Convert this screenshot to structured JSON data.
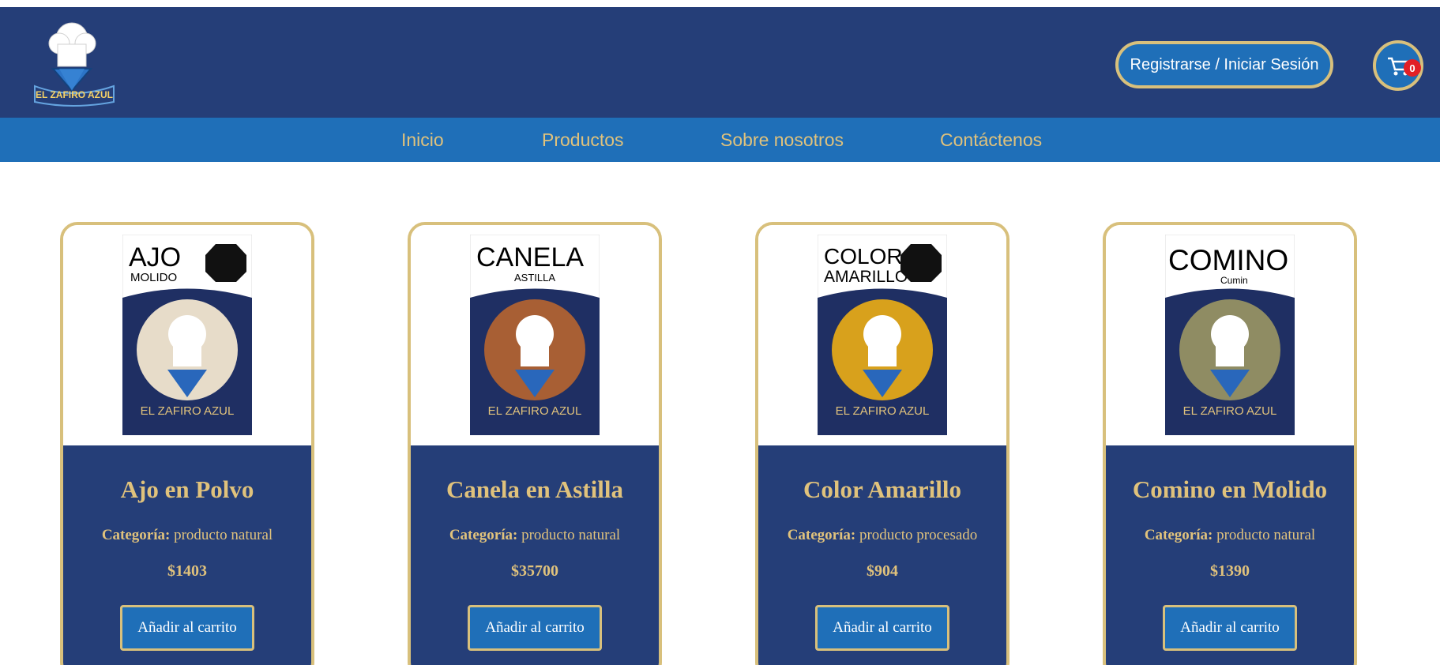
{
  "brand": {
    "logo_text": "EL ZAFIRO AZUL"
  },
  "header": {
    "auth_label": "Registrarse / Iniciar Sesión",
    "cart_count": "0",
    "cart_icon": "shopping-cart-icon"
  },
  "nav": {
    "items": [
      "Inicio",
      "Productos",
      "Sobre nosotros",
      "Contáctenos"
    ]
  },
  "products": [
    {
      "title": "Ajo en Polvo",
      "category_label": "Categoría:",
      "category": "producto natural",
      "price": "$1403",
      "button": "Añadir al carrito",
      "package_name": "AJO",
      "package_sub": "MOLIDO",
      "fill": "#e7dcc9"
    },
    {
      "title": "Canela en Astilla",
      "category_label": "Categoría:",
      "category": "producto natural",
      "price": "$35700",
      "button": "Añadir al carrito",
      "package_name": "CANELA",
      "package_sub": "ASTILLA",
      "fill": "#a85f34"
    },
    {
      "title": "Color Amarillo",
      "category_label": "Categoría:",
      "category": "producto procesado",
      "price": "$904",
      "button": "Añadir al carrito",
      "package_name": "COLOR",
      "package_sub": "AMARILLO",
      "fill": "#d8a11c"
    },
    {
      "title": "Comino en Molido",
      "category_label": "Categoría:",
      "category": "producto natural",
      "price": "$1390",
      "button": "Añadir al carrito",
      "package_name": "COMINO",
      "package_sub": "Cumin",
      "fill": "#8f8c63"
    }
  ],
  "colors": {
    "navy": "#253e78",
    "blue": "#1f6fb8",
    "gold": "#d8c07c",
    "badge": "#e21f26"
  }
}
